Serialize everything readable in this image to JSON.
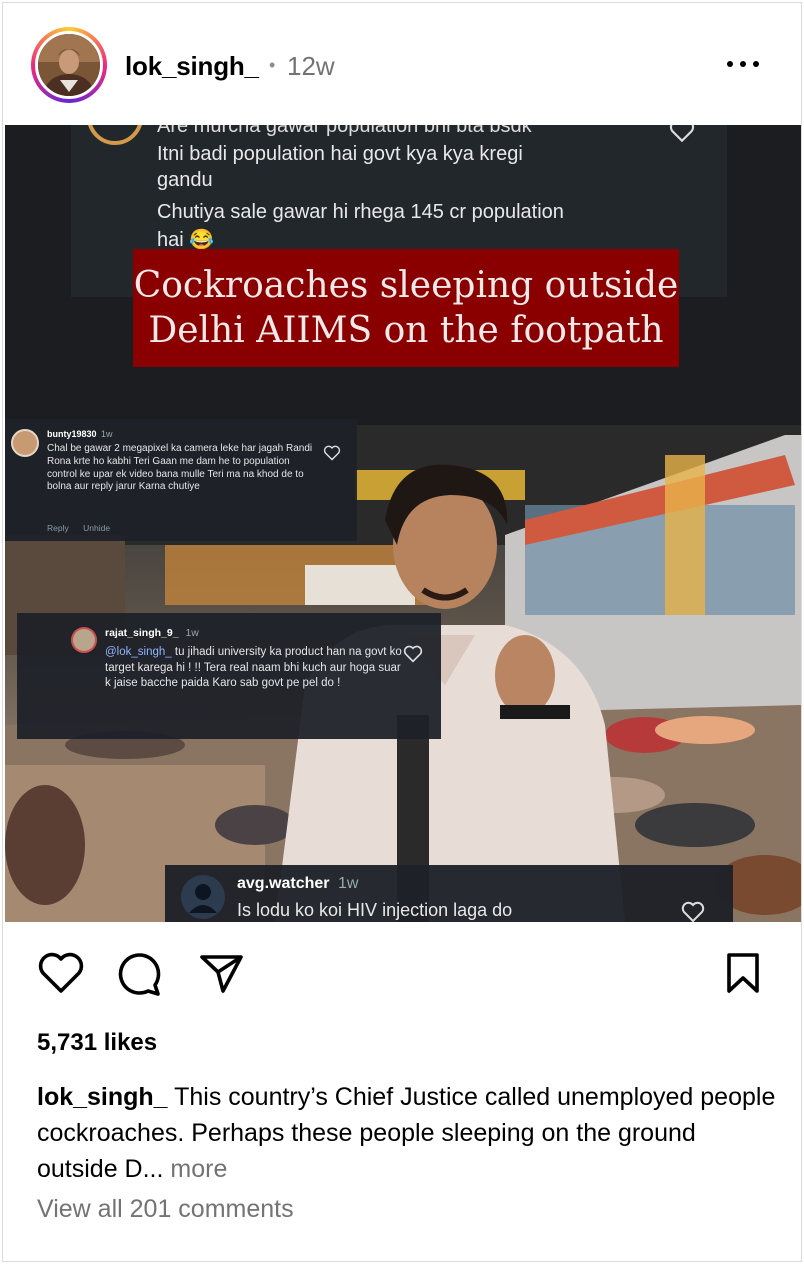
{
  "post": {
    "username": "lok_singh_",
    "separator": "•",
    "age": "12w",
    "likes": "5,731 likes",
    "caption_user": "lok_singh_",
    "caption_text": "This country’s Chief Justice called unemployed people cockroaches. Perhaps these people sleeping on the ground outside D...",
    "caption_more": "more",
    "view_comments": "View all 201 comments"
  },
  "media": {
    "top_comment": {
      "cut_line": "Are murcha gawar population bhi bta bsdk",
      "line1": "Itni badi population hai govt kya kya kregi",
      "line2": "gandu",
      "line3": "Chutiya sale gawar hi rhega 145 cr population",
      "line4": "hai 😂"
    },
    "banner": {
      "line1": "Cockroaches sleeping outside",
      "line2": "Delhi AIIMS on the footpath"
    },
    "comment_bunty": {
      "user": "bunty19830",
      "time": "1w",
      "text": "Chal be gawar 2 megapixel ka camera leke har jagah Randi Rona krte ho kabhi Teri Gaan me dam he to population control ke upar ek video bana mulle Teri ma na khod de to bolna aur reply jarur Karna chutiye",
      "reply": "Reply",
      "unhide": "Unhide"
    },
    "comment_rajat": {
      "user": "rajat_singh_9_",
      "time": "1w",
      "mention": "@lok_singh_",
      "text": "tu jihadi university ka product han na govt ko target karega hi ! !! Tera real naam bhi kuch aur hoga suar k jaise bacche paida Karo sab govt pe pel do !"
    },
    "comment_avg": {
      "user": "avg.watcher",
      "time": "1w",
      "text": "Is lodu ko koi HIV injection laga do"
    }
  },
  "icons": {
    "like": "heart-icon",
    "comment": "comment-icon",
    "share": "send-icon",
    "save": "bookmark-icon",
    "options": "more-options-icon"
  }
}
